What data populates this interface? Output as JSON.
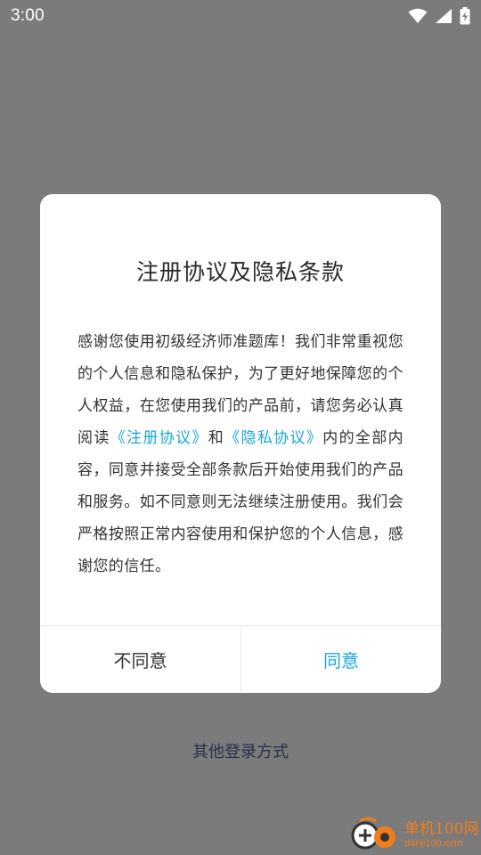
{
  "status_bar": {
    "time": "3:00",
    "icons": [
      "wifi-icon",
      "signal-icon",
      "battery-charging-icon"
    ]
  },
  "dialog": {
    "title": "注册协议及隐私条款",
    "body_part1": "感谢您使用初级经济师准题库！我们非常重视您的个人信息和隐私保护，为了更好地保障您的个人权益，在您使用我们的产品前，请您务必认真阅读",
    "link_register": "《注册协议》",
    "body_and": "和",
    "link_privacy": "《隐私协议》",
    "body_part2": "内的全部内容，同意并接受全部条款后开始使用我们的产品和服务。如不同意则无法继续注册使用。我们会严格按照正常内容使用和保护您的个人信息，感谢您的信任。",
    "disagree_label": "不同意",
    "agree_label": "同意"
  },
  "other_login_label": "其他登录方式",
  "watermark": {
    "title": "单机100网",
    "url": "danji100.com"
  },
  "colors": {
    "overlay": "#7b7b7b",
    "link": "#1aa7d8",
    "watermark": "#f07d1b"
  }
}
